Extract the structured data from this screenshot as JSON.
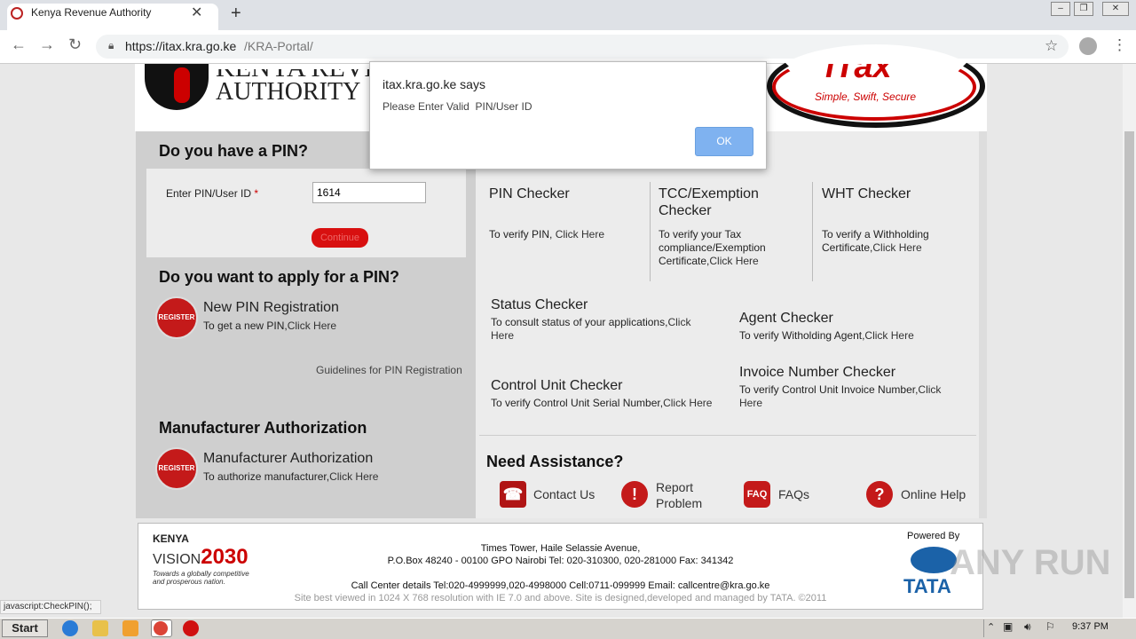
{
  "browser": {
    "tab_title": "Kenya Revenue Authority",
    "url_host": "https://itax.kra.go.ke",
    "url_path": "/KRA-Portal/",
    "status_text": "javascript:CheckPIN();"
  },
  "header": {
    "kra_line1": "Kenya Reven",
    "kra_line2": "Authority",
    "itax_logo_text": "iTax",
    "itax_slogan": "Simple, Swift, Secure"
  },
  "dialog": {
    "title": "itax.kra.go.ke says",
    "message": "Please Enter Valid  PIN/User ID",
    "ok_label": "OK"
  },
  "pin_section": {
    "title": "Do you have a PIN?",
    "label": "Enter PIN/User ID",
    "required_mark": "*",
    "value": "1614",
    "continue_label": "Continue"
  },
  "apply_section": {
    "title": "Do you want to apply for a PIN?",
    "icon_text": "REGISTER",
    "option_title": "New PIN Registration",
    "option_desc": "To get a new PIN,",
    "option_link": "Click Here",
    "guidelines": "Guidelines for PIN Registration"
  },
  "manufacturer_section": {
    "title": "Manufacturer Authorization",
    "icon_text": "REGISTER",
    "option_title": "Manufacturer Authorization",
    "option_desc": "To authorize manufacturer,",
    "option_link": "Click Here"
  },
  "checkers": {
    "pin": {
      "title": "PIN Checker",
      "desc": "To verify PIN, ",
      "link": "Click Here"
    },
    "tcc": {
      "title1": "TCC/Exemption",
      "title2": "Checker",
      "desc1": "To verify your Tax",
      "desc2": "compliance/Exemption",
      "desc3": "Certificate,",
      "link": "Click Here"
    },
    "wht": {
      "title": "WHT Checker",
      "desc1": "To verify a Withholding",
      "desc2": "Certificate,",
      "link": "Click Here"
    },
    "status": {
      "title": "Status Checker",
      "desc1": "To consult status of your applications,",
      "link1": "Click",
      "link2": "Here"
    },
    "agent": {
      "title": "Agent Checker",
      "desc": "To verify Witholding Agent,",
      "link": "Click Here"
    },
    "control_unit": {
      "title": "Control Unit Checker",
      "desc": "To verify Control Unit Serial Number,",
      "link": "Click Here"
    },
    "invoice": {
      "title": "Invoice Number Checker",
      "desc1": "To verify Control Unit Invoice Number,",
      "link1": "Click",
      "link2": "Here"
    }
  },
  "assistance": {
    "title": "Need Assistance?",
    "contact": "Contact Us",
    "report1": "Report",
    "report2": "Problem",
    "faqs": "FAQs",
    "help": "Online Help"
  },
  "footer": {
    "address1": "Times Tower, Haile Selassie Avenue,",
    "address2": "P.O.Box 48240 - 00100 GPO Nairobi Tel: 020-310300, 020-281000 Fax: 341342",
    "callcenter": "Call Center details Tel:020-4999999,020-4998000 Cell:0711-099999 Email: callcentre@kra.go.ke",
    "site_note": "Site best viewed in 1024 X 768 resolution with IE 7.0 and above. Site is designed,developed and managed by TATA. ©2011",
    "vision_kenya": "KENYA",
    "vision_word": "VISION",
    "vision_year": "2030",
    "vision_tag1": "Towards a globally competitive",
    "vision_tag2": "and prosperous nation.",
    "powered_by": "Powered By",
    "tata": "TATA"
  },
  "watermark": "ANY RUN",
  "taskbar": {
    "start": "Start",
    "clock": "9:37 PM"
  },
  "colors": {
    "kra_red": "#c00000",
    "dialog_button": "#7fb2f0",
    "tata_blue": "#1b62a8"
  }
}
